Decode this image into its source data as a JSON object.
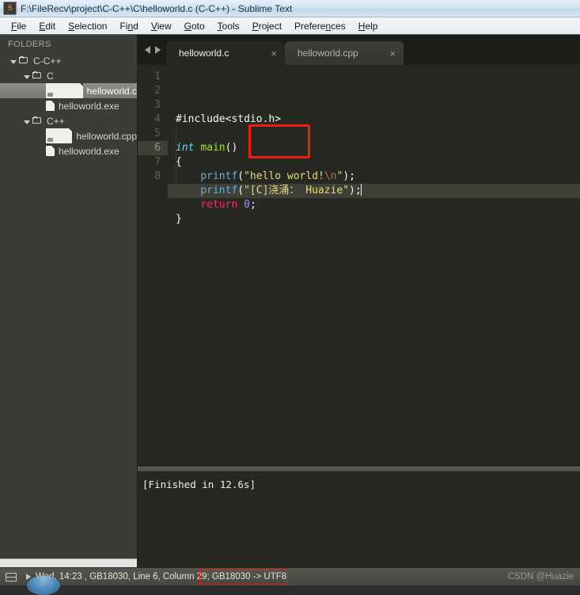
{
  "window": {
    "title": "F:\\FileRecv\\project\\C-C++\\C\\helloworld.c (C-C++) - Sublime Text",
    "app_icon": "sublime-text-icon",
    "icon_letter": "S"
  },
  "menubar": {
    "items": [
      {
        "label": "File",
        "accel": "F"
      },
      {
        "label": "Edit",
        "accel": "E"
      },
      {
        "label": "Selection",
        "accel": "S"
      },
      {
        "label": "Find",
        "accel": "n"
      },
      {
        "label": "View",
        "accel": "V"
      },
      {
        "label": "Goto",
        "accel": "G"
      },
      {
        "label": "Tools",
        "accel": "T"
      },
      {
        "label": "Project",
        "accel": "P"
      },
      {
        "label": "Preferences",
        "accel": "n"
      },
      {
        "label": "Help",
        "accel": "H"
      }
    ]
  },
  "sidebar": {
    "header": "FOLDERS",
    "tree": [
      {
        "label": "C-C++",
        "type": "folder",
        "depth": 0,
        "expanded": true,
        "selected": false
      },
      {
        "label": "C",
        "type": "folder",
        "depth": 1,
        "expanded": true,
        "selected": false
      },
      {
        "label": "helloworld.c",
        "type": "file-code",
        "depth": 2,
        "expanded": false,
        "selected": true
      },
      {
        "label": "helloworld.exe",
        "type": "file",
        "depth": 2,
        "expanded": false,
        "selected": false
      },
      {
        "label": "C++",
        "type": "folder",
        "depth": 1,
        "expanded": true,
        "selected": false
      },
      {
        "label": "helloworld.cpp",
        "type": "file-code",
        "depth": 2,
        "expanded": false,
        "selected": false
      },
      {
        "label": "helloworld.exe",
        "type": "file",
        "depth": 2,
        "expanded": false,
        "selected": false
      }
    ]
  },
  "tabs": {
    "prev_icon": "chevron-left-icon",
    "next_icon": "chevron-right-icon",
    "close_glyph": "×",
    "items": [
      {
        "label": "helloworld.c",
        "active": true
      },
      {
        "label": "helloworld.cpp",
        "active": false
      }
    ]
  },
  "editor": {
    "line_numbers": [
      "1",
      "2",
      "3",
      "4",
      "5",
      "6",
      "7",
      "8"
    ],
    "active_line": 6,
    "lines": [
      {
        "n": 1,
        "tokens": [
          {
            "t": "#include<stdio.h>",
            "c": "k-pre"
          }
        ]
      },
      {
        "n": 2,
        "tokens": []
      },
      {
        "n": 3,
        "tokens": [
          {
            "t": "int",
            "c": "k-key"
          },
          {
            "t": " ",
            "c": "k-pn"
          },
          {
            "t": "main",
            "c": "k-fn"
          },
          {
            "t": "()",
            "c": "k-pn"
          }
        ]
      },
      {
        "n": 4,
        "tokens": [
          {
            "t": "{",
            "c": "k-pn"
          }
        ]
      },
      {
        "n": 5,
        "tokens": [
          {
            "t": "    ",
            "c": "k-pn"
          },
          {
            "t": "printf",
            "c": "k-call"
          },
          {
            "t": "(",
            "c": "k-pn"
          },
          {
            "t": "\"hello world!",
            "c": "k-str"
          },
          {
            "t": "\\n",
            "c": "k-esc"
          },
          {
            "t": "\"",
            "c": "k-str"
          },
          {
            "t": ");",
            "c": "k-pn"
          }
        ]
      },
      {
        "n": 6,
        "tokens": [
          {
            "t": "    ",
            "c": "k-pn"
          },
          {
            "t": "printf",
            "c": "k-call"
          },
          {
            "t": "(",
            "c": "k-pn"
          },
          {
            "t": "\"[C]浇涌： Huazie\"",
            "c": "k-str"
          },
          {
            "t": ");",
            "c": "k-pn"
          }
        ]
      },
      {
        "n": 7,
        "tokens": [
          {
            "t": "    ",
            "c": "k-pn"
          },
          {
            "t": "return",
            "c": "k-ret"
          },
          {
            "t": " ",
            "c": "k-pn"
          },
          {
            "t": "0",
            "c": "k-num"
          },
          {
            "t": ";",
            "c": "k-pn"
          }
        ]
      },
      {
        "n": 8,
        "tokens": [
          {
            "t": "}",
            "c": "k-pn"
          }
        ]
      }
    ],
    "annotation_box_color": "#f01c10"
  },
  "build_panel": {
    "output": "[Finished in 12.6s]"
  },
  "statusbar": {
    "panel_icon": "panel-toggle-icon",
    "arrow_icon": "play-arrow-icon",
    "text": "Wed, 14:23 , GB18030, Line 6, Column 29; GB18030 -> UTF8",
    "highlight_color": "#f01c10",
    "watermark": "CSDN @Huazie"
  }
}
